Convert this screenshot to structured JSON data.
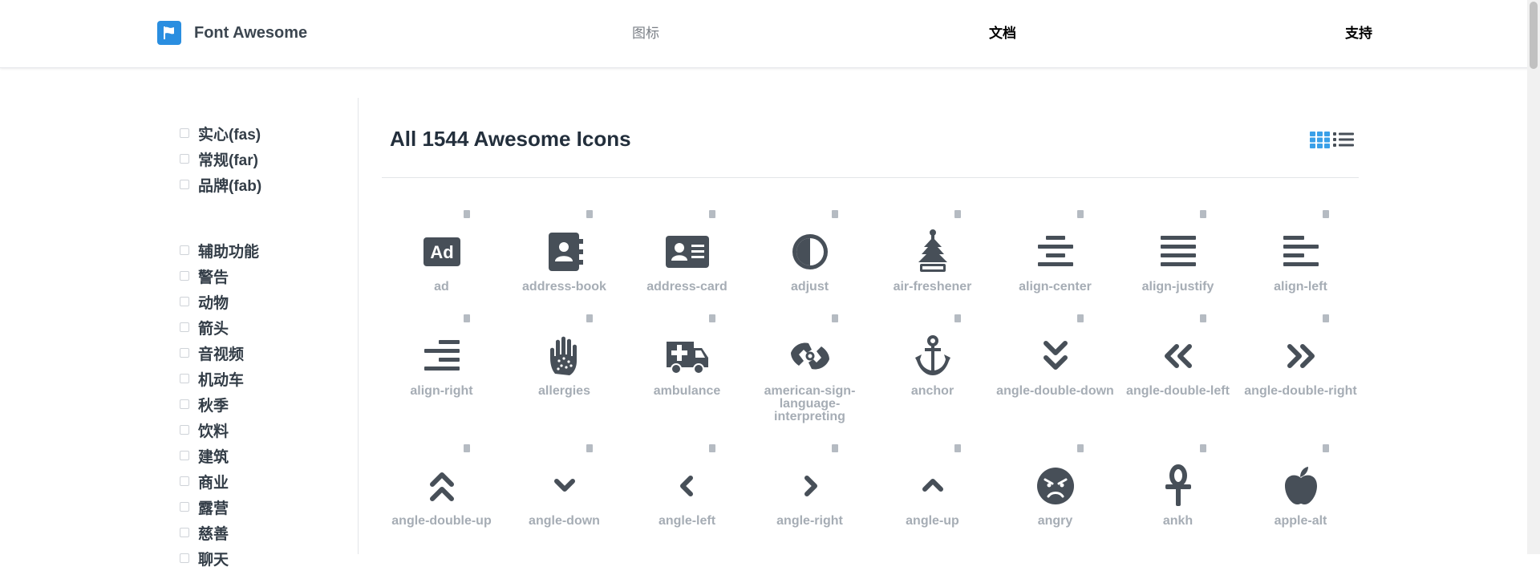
{
  "header": {
    "brand": "Font Awesome",
    "nav": [
      "图标",
      "文档",
      "支持"
    ]
  },
  "sidebar": {
    "styles": [
      "实心(fas)",
      "常规(far)",
      "品牌(fab)"
    ],
    "categories": [
      "辅助功能",
      "警告",
      "动物",
      "箭头",
      "音视频",
      "机动车",
      "秋季",
      "饮料",
      "建筑",
      "商业",
      "露营",
      "慈善",
      "聊天"
    ]
  },
  "main": {
    "title": "All 1544 Awesome Icons",
    "icons": [
      {
        "label": "ad",
        "icon": "ad-icon"
      },
      {
        "label": "address-book",
        "icon": "address-book-icon"
      },
      {
        "label": "address-card",
        "icon": "address-card-icon"
      },
      {
        "label": "adjust",
        "icon": "adjust-icon"
      },
      {
        "label": "air-freshener",
        "icon": "air-freshener-icon"
      },
      {
        "label": "align-center",
        "icon": "align-center-icon"
      },
      {
        "label": "align-justify",
        "icon": "align-justify-icon"
      },
      {
        "label": "align-left",
        "icon": "align-left-icon"
      },
      {
        "label": "align-right",
        "icon": "align-right-icon"
      },
      {
        "label": "allergies",
        "icon": "allergies-icon"
      },
      {
        "label": "ambulance",
        "icon": "ambulance-icon"
      },
      {
        "label": "american-sign-language-interpreting",
        "icon": "american-sign-language-interpreting-icon"
      },
      {
        "label": "anchor",
        "icon": "anchor-icon"
      },
      {
        "label": "angle-double-down",
        "icon": "angle-double-down-icon"
      },
      {
        "label": "angle-double-left",
        "icon": "angle-double-left-icon"
      },
      {
        "label": "angle-double-right",
        "icon": "angle-double-right-icon"
      },
      {
        "label": "angle-double-up",
        "icon": "angle-double-up-icon"
      },
      {
        "label": "angle-down",
        "icon": "angle-down-icon"
      },
      {
        "label": "angle-left",
        "icon": "angle-left-icon"
      },
      {
        "label": "angle-right",
        "icon": "angle-right-icon"
      },
      {
        "label": "angle-up",
        "icon": "angle-up-icon"
      },
      {
        "label": "angry",
        "icon": "angry-icon"
      },
      {
        "label": "ankh",
        "icon": "ankh-icon"
      },
      {
        "label": "apple-alt",
        "icon": "apple-alt-icon"
      }
    ]
  },
  "colors": {
    "icon": "#474f58",
    "label": "#a6adb5",
    "accent": "#2a8ee0"
  }
}
